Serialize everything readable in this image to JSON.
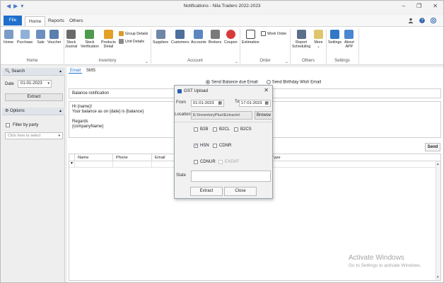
{
  "window": {
    "title": "Notifications - Nila Traders 2022-2023",
    "controls": {
      "minimize": "–",
      "restore": "❐",
      "close": "✕"
    },
    "quick_access": [
      "◀",
      "▶",
      "▾"
    ]
  },
  "ribbon_tabs": {
    "file": "File",
    "home": "Home",
    "reports": "Reports",
    "others": "Others"
  },
  "ribbon": {
    "home_group": {
      "label": "Home",
      "buttons": [
        "Home",
        "Purchase",
        "Sale",
        "Voucher"
      ]
    },
    "inventory_group": {
      "label": "Inventory",
      "stock_journal": [
        "Stock",
        "Journal"
      ],
      "stock_verification": [
        "Stock",
        "Verification"
      ],
      "products_detail": [
        "Products",
        "Detail"
      ],
      "group_details": "Group Details",
      "unit_details": "Unit Details"
    },
    "account_group": {
      "label": "Account",
      "buttons": [
        "Suppliers",
        "Customers",
        "Accounts",
        "Brokers",
        "Coupon"
      ]
    },
    "order_group": {
      "label": "Order",
      "estimation": "Estimation",
      "work_order": "Work Order"
    },
    "others_group": {
      "label": "Others",
      "report_scheduling": [
        "Report",
        "Scheduling"
      ],
      "more": "More"
    },
    "settings_group": {
      "label": "Settings",
      "settings": "Settings",
      "about": [
        "About",
        "APP"
      ]
    }
  },
  "left_panel": {
    "search_header": "Search",
    "date_label": "Date",
    "date_value": "01-01-2023",
    "extract": "Extract",
    "options_header": "Options",
    "filter_by_party": "Filter by party",
    "party_placeholder": "Click here to select"
  },
  "main": {
    "tabs": [
      "Email",
      "SMS"
    ],
    "radio_due": "Send Balance due Email",
    "radio_birthday": "Send Birthday Wish Email",
    "subject": "Balance notification",
    "body_lines": [
      "Hi {name}!",
      "Your balance as on {date} is {balance}",
      "",
      "Regards",
      "{companyName}"
    ],
    "send": "Send",
    "grid_columns": [
      "Name",
      "Phone",
      "Email",
      "Type"
    ],
    "row_marker": "▼"
  },
  "watermark": {
    "line1": "Activate Windows",
    "line2": "Go to Settings to activate Windows."
  },
  "dialog": {
    "title": "GST Upload",
    "close": "✕",
    "from_label": "From",
    "from_value": "01-01-2023",
    "to_label": "To",
    "to_value": "17-01-2023",
    "location_label": "Location",
    "location_value": "E:\\InventoryPlus\\Extracts\\",
    "browse": "Browse",
    "options": {
      "b2b": "B2B",
      "b2cl": "B2CL",
      "b2cs": "B2CS",
      "hsn": "HSN",
      "cdnr": "CDNR",
      "cdnur": "CDNUR",
      "exemt": "EXEMT"
    },
    "state_label": "State",
    "extract": "Extract",
    "close_btn": "Close"
  },
  "colors": {
    "accent": "#1f6fcc",
    "background": "#f0f0f0"
  }
}
